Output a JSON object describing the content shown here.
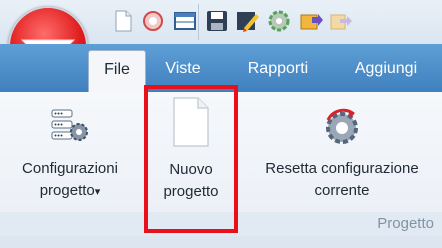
{
  "tabs": [
    {
      "label": "File",
      "active": true
    },
    {
      "label": "Viste",
      "active": false
    },
    {
      "label": "Rapporti",
      "active": false
    },
    {
      "label": "Aggiungi",
      "active": false
    }
  ],
  "ribbon": {
    "group_label": "Progetto",
    "buttons": [
      {
        "line1": "Configurazioni",
        "line2": "progetto",
        "dropdown": "▾"
      },
      {
        "line1": "Nuovo",
        "line2": "progetto",
        "highlighted": true
      },
      {
        "line1": "Resetta configurazione",
        "line2": "corrente"
      }
    ]
  },
  "quick_access": [
    "new-document-icon",
    "refresh-icon",
    "window-icon",
    "save-icon",
    "edit-icon",
    "settings-icon",
    "folder-arrow-icon",
    "export-icon"
  ],
  "colors": {
    "tab_bar": "#4f8fcc",
    "app_button": "#e01b1b",
    "highlight": "#e8101a"
  }
}
